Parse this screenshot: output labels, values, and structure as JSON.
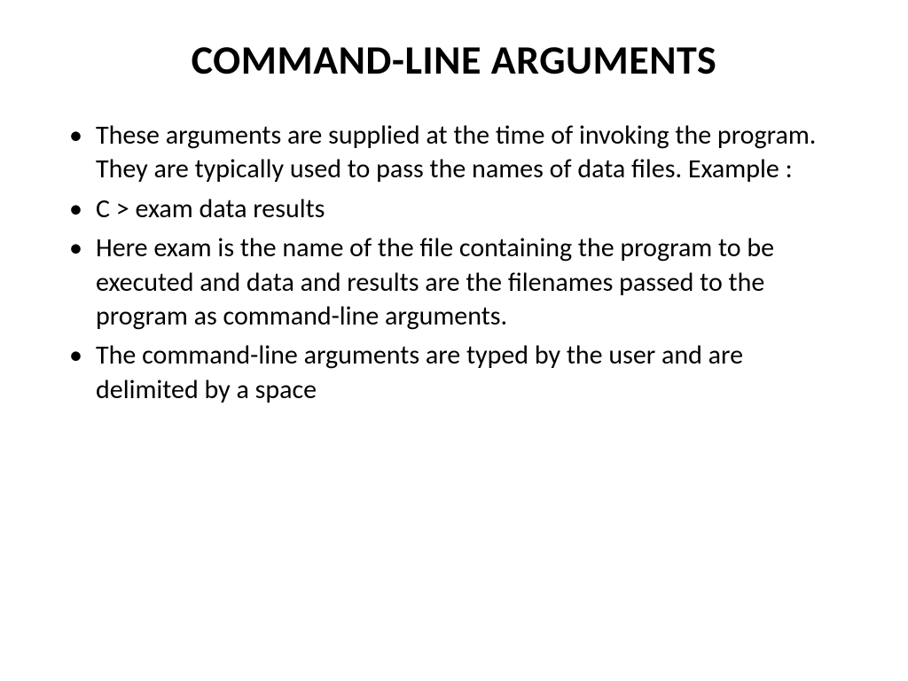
{
  "slide": {
    "title": "COMMAND-LINE ARGUMENTS",
    "bullets": [
      "These arguments are supplied at the time of invoking the program. They are typically used to pass the names of data files. Example :",
      "C > exam data results",
      "Here  exam is the name of the file containing the program to be executed and data and results are the filenames passed to the program as command-line arguments.",
      "The command-line arguments are typed by the user and are delimited by a space"
    ]
  }
}
